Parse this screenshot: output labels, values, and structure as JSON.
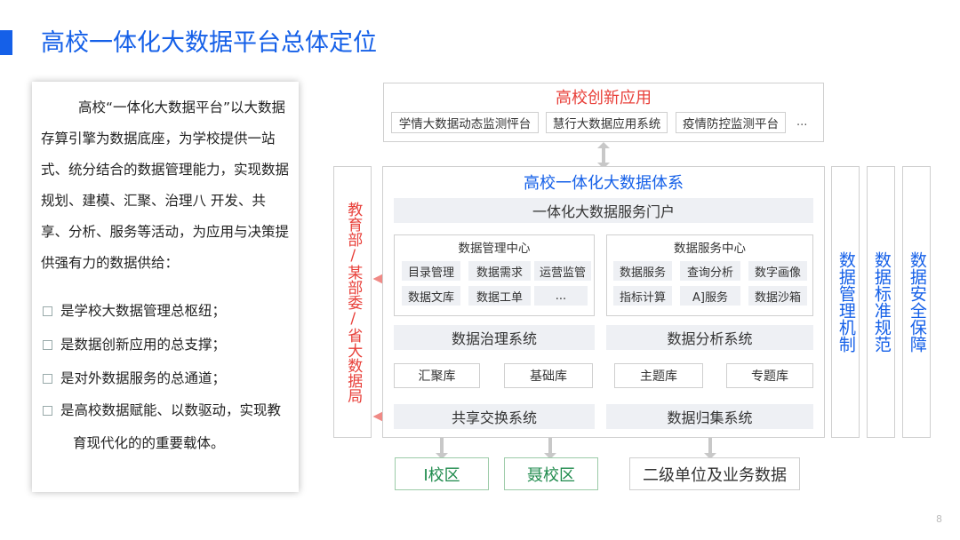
{
  "page": {
    "title": "高校一体化大数据平台总体定位",
    "page_number": "8"
  },
  "left_panel": {
    "paragraph": "高校“一体化大数据平台”以大数据存算引擎为数据底座，为学校提供一站式、统分结合的数据管理能力，实现数据规划、建模、汇聚、治理八 开发、共享、分析、服务等活动，为应用与决策提供强有力的数据供给：",
    "bullets": [
      "是学校大数据管理总枢纽；",
      "是数据创新应用的总支撑；",
      "是对外数据服务的总通道；",
      "是高校数据赋能、以数驱动，实现教"
    ],
    "bullet_continuation": "育现代化的的重要载体。"
  },
  "diagram": {
    "apps": {
      "title": "高校创新应用",
      "items": [
        "学情大数据动态监测怦台",
        "慧行大数据应用系统",
        "疫情防控监测平台",
        "..."
      ]
    },
    "left_side": "教育部/某部委/省大数据局",
    "system": {
      "title": "高校一体化大数据体系",
      "portal": "一体化大数据服务门户",
      "mgmt_center": {
        "title": "数据管理中心",
        "items": [
          "目录管理",
          "数据需求",
          "运营监管",
          "数据文库",
          "数据工单",
          "..."
        ]
      },
      "service_center": {
        "title": "数据服务中心",
        "items": [
          "数据服务",
          "查询分析",
          "数字画像",
          "指标计算",
          "A]服务",
          "数据沙箱"
        ]
      },
      "governance": "数据治理系统",
      "analysis": "数据分析系统",
      "libs": [
        "汇聚库",
        "基础库",
        "主题库",
        "专题库"
      ],
      "exchange": "共享交换系统",
      "collect": "数据归集系统"
    },
    "right_columns": [
      "数据管理机制",
      "数据标准规范",
      "数据安全保障"
    ],
    "sources": [
      "I校区",
      "聂校区",
      "二级单位及业务数据"
    ]
  },
  "colors": {
    "brand_blue": "#1560e8",
    "accent_red": "#e8403a",
    "source_green": "#1e8a4c",
    "arrow_red": "#f08a86"
  }
}
